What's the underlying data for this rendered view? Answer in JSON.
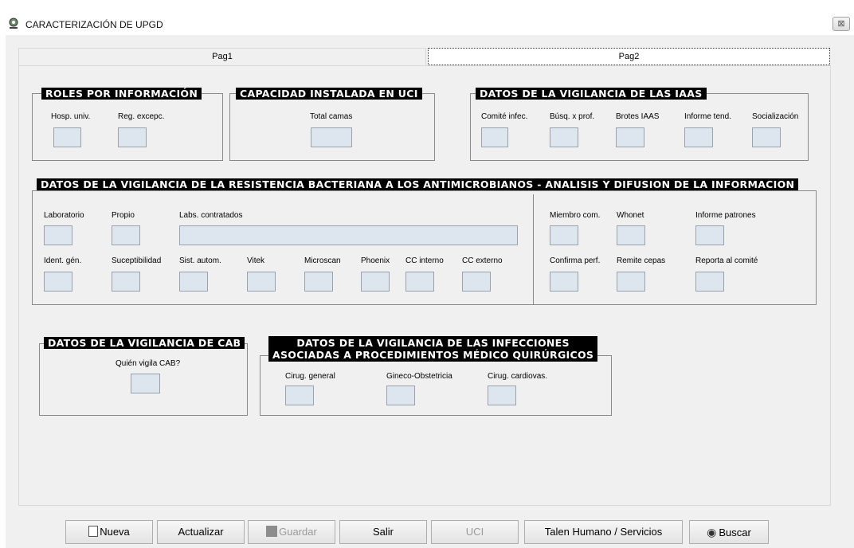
{
  "window": {
    "title": "CARACTERIZACIÓN DE UPGD",
    "close_glyph": "⊠"
  },
  "tabs": [
    {
      "label": "Pag1"
    },
    {
      "label": "Pag2"
    }
  ],
  "roles": {
    "title": "ROLES POR INFORMACIÓN",
    "hosp": "Hosp. univ.",
    "reg": "Reg. excepc."
  },
  "uci": {
    "title": "CAPACIDAD INSTALADA EN UCI",
    "total": "Total camas"
  },
  "iaas": {
    "title": "DATOS DE LA VIGILANCIA DE LAS IAAS",
    "comite": "Comité infec.",
    "busq": "Búsq. x prof.",
    "brotes": "Brotes IAAS",
    "informe": "Informe tend.",
    "social": "Socialización"
  },
  "resist": {
    "title": "DATOS DE LA VIGILANCIA DE LA RESISTENCIA BACTERIANA  A LOS ANTIMICROBIANOS - ANALISIS Y DIFUSION DE LA INFORMACION",
    "laboratorio": "Laboratorio",
    "propio": "Propio",
    "labs": "Labs. contratados",
    "ident": "Ident. gén.",
    "suscep": "Suceptibilidad",
    "sist": "Sist. autom.",
    "vitek": "Vitek",
    "microscan": "Microscan",
    "phoenix": "Phoenix",
    "cc_int": "CC interno",
    "cc_ext": "CC externo",
    "miembro": "Miembro com.",
    "whonet": "Whonet",
    "inf_patrones": "Informe patrones",
    "confirma": "Confirma perf.",
    "remite": "Remite cepas",
    "reporta": "Reporta al comité"
  },
  "cab": {
    "title": "DATOS DE LA VIGILANCIA DE CAB",
    "quien": "Quién vigila CAB?"
  },
  "infec": {
    "title_line1": "DATOS DE LA VIGILANCIA DE LAS INFECCIONES",
    "title_line2": "ASOCIADAS A PROCEDIMIENTOS MÉDICO QUIRÚRGICOS",
    "cirug": "Cirug. general",
    "gineco": "Gineco-Obstetricia",
    "cardio": "Cirug. cardiovas."
  },
  "buttons": {
    "nueva": "Nueva",
    "actualizar": "Actualizar",
    "guardar": "Guardar",
    "salir": "Salir",
    "uci": "UCI",
    "talen": "Talen Humano / Servicios",
    "buscar": "Buscar"
  }
}
